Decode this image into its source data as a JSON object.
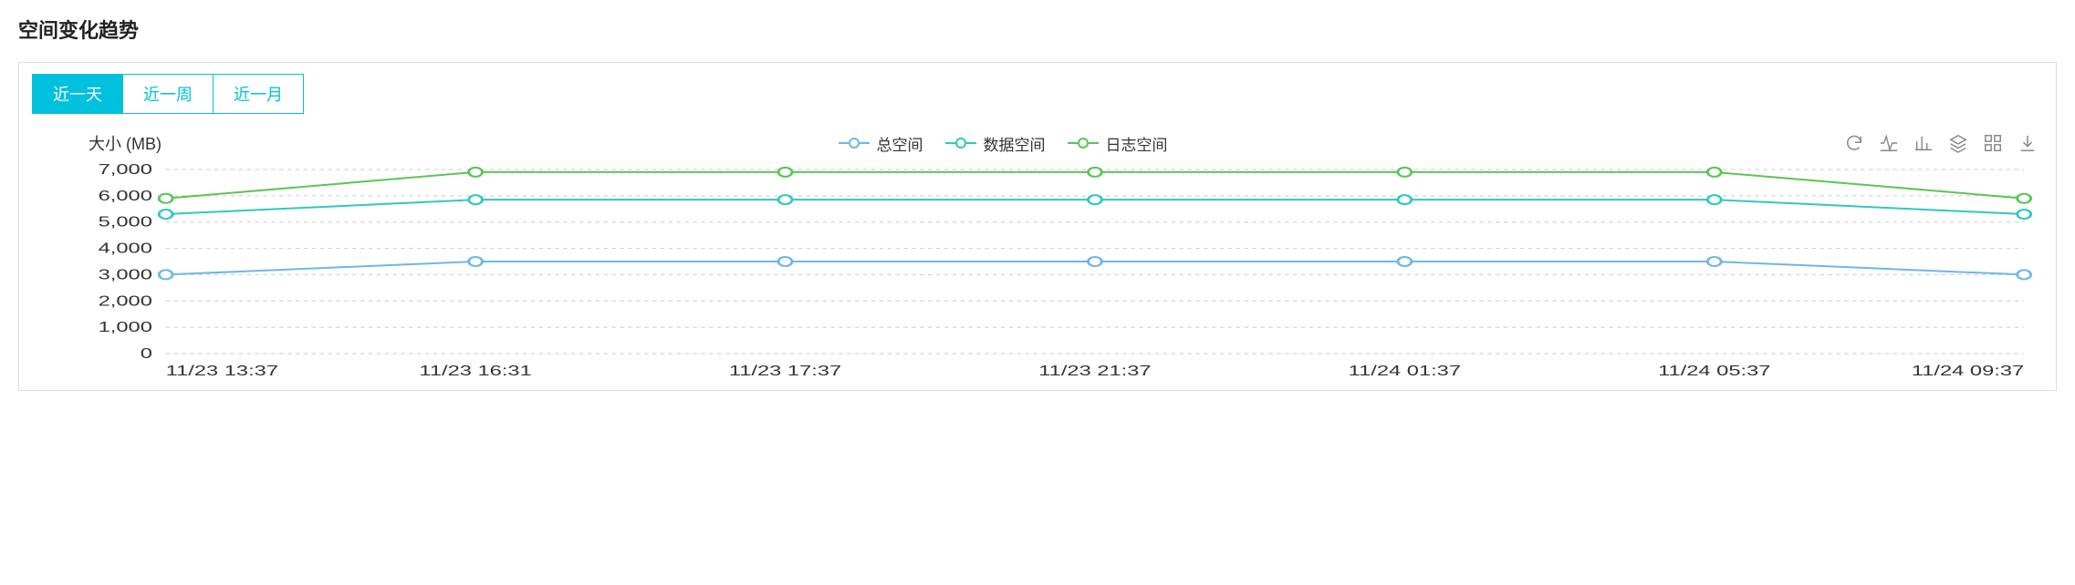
{
  "title": "空间变化趋势",
  "tabs": [
    {
      "label": "近一天",
      "active": true
    },
    {
      "label": "近一周",
      "active": false
    },
    {
      "label": "近一月",
      "active": false
    }
  ],
  "toolbar_icons": [
    "refresh-icon",
    "wave-icon",
    "bar-chart-icon",
    "layers-icon",
    "grid-icon",
    "download-icon"
  ],
  "chart_data": {
    "type": "line",
    "ylabel": "大小 (MB)",
    "ylim": [
      0,
      7000
    ],
    "yticks": [
      0,
      1000,
      2000,
      3000,
      4000,
      5000,
      6000,
      7000
    ],
    "ytick_labels": [
      "0",
      "1,000",
      "2,000",
      "3,000",
      "4,000",
      "5,000",
      "6,000",
      "7,000"
    ],
    "categories": [
      "11/23 13:37",
      "11/23 16:31",
      "11/23 17:37",
      "11/23 21:37",
      "11/24 01:37",
      "11/24 05:37",
      "11/24 09:37"
    ],
    "series": [
      {
        "name": "总空间",
        "color": "#6fb6e8",
        "values": [
          3000,
          3500,
          3500,
          3500,
          3500,
          3500,
          3000
        ]
      },
      {
        "name": "数据空间",
        "color": "#2fc8c0",
        "values": [
          5300,
          5850,
          5850,
          5850,
          5850,
          5850,
          5300
        ]
      },
      {
        "name": "日志空间",
        "color": "#5bc455",
        "values": [
          5900,
          6900,
          6900,
          6900,
          6900,
          6900,
          5900
        ]
      }
    ]
  }
}
